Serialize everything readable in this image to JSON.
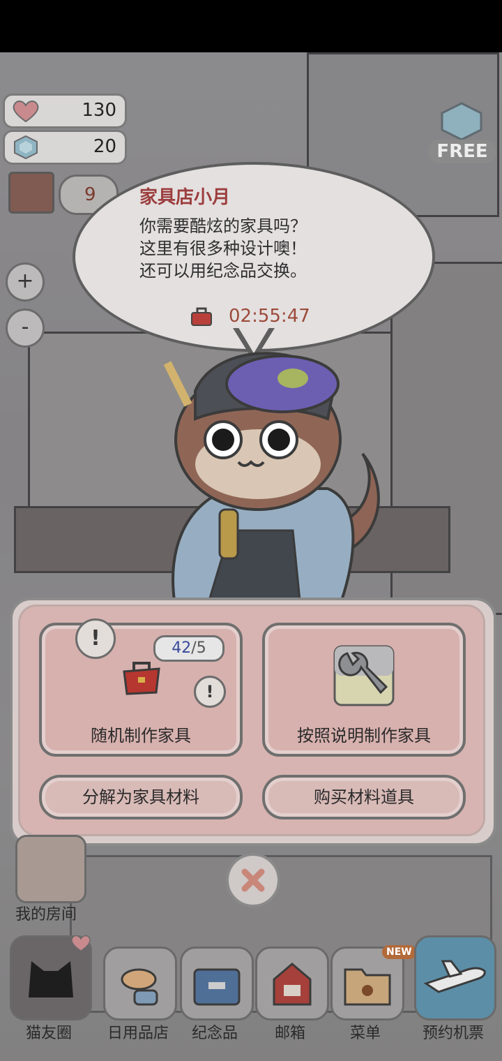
{
  "hud": {
    "hearts": "130",
    "gems": "20",
    "messages": "9",
    "free_label": "FREE",
    "zoom_in": "+",
    "zoom_out": "-"
  },
  "dialog": {
    "speaker": "家具店小月",
    "lines": [
      "你需要酷炫的家具吗？",
      "这里有很多种设计噢！",
      "还可以用纪念品交换。"
    ],
    "timer": "02:55:47"
  },
  "panel": {
    "random_craft": {
      "label": "随机制作家具",
      "count": "42",
      "count_max": "/5"
    },
    "recipe_craft": {
      "label": "按照说明制作家具"
    },
    "dismantle": "分解为家具材料",
    "buy_materials": "购买材料道具"
  },
  "room_label": "我的房间",
  "dock": [
    "猫友圈",
    "日用品店",
    "纪念品",
    "邮箱",
    "菜单",
    "预约机票"
  ],
  "new_tag": "NEW",
  "colors": {
    "speaker": "#9c3d3d",
    "timer": "#9c4a3a",
    "panel": "#d7b4b1",
    "count": "#3a4a9a"
  },
  "icons": [
    "heart-icon",
    "gem-icon",
    "toolbox-icon",
    "wrench-icon",
    "close-icon",
    "plane-icon",
    "mailbox-icon",
    "folder-icon"
  ]
}
